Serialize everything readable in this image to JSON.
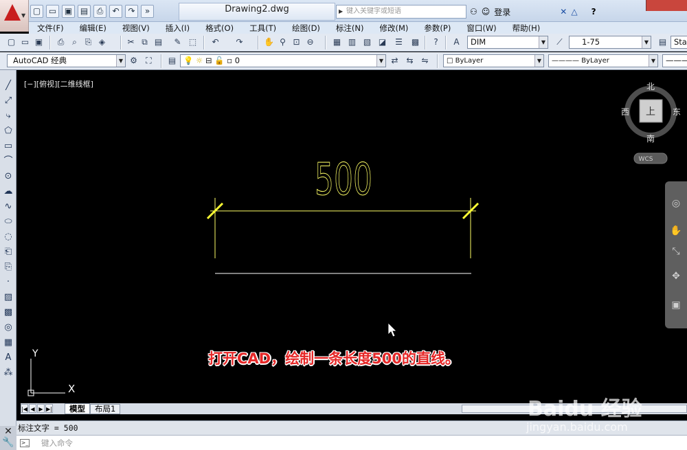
{
  "window": {
    "title": "Drawing2.dwg",
    "search_placeholder": "键入关键字或短语",
    "login_label": "登录"
  },
  "menu": {
    "items": [
      "文件(F)",
      "编辑(E)",
      "视图(V)",
      "插入(I)",
      "格式(O)",
      "工具(T)",
      "绘图(D)",
      "标注(N)",
      "修改(M)",
      "参数(P)",
      "窗口(W)",
      "帮助(H)"
    ]
  },
  "toolbar": {
    "dim_style": "DIM",
    "scale": "1-75",
    "text_style": "Sta",
    "workspace": "AutoCAD 经典",
    "layer": "0",
    "color": "ByLayer",
    "linetype": "ByLayer"
  },
  "viewport": {
    "label": "[−][俯视][二维线框]",
    "dimension_text": "500"
  },
  "viewcube": {
    "north": "北",
    "south": "南",
    "east": "东",
    "west": "西",
    "face": "上",
    "wcs_label": "WCS"
  },
  "ucs": {
    "y_label": "Y",
    "x_label": "X"
  },
  "tabs": {
    "model": "模型",
    "layout1": "布局1"
  },
  "command": {
    "history": "标注文字 = 500",
    "placeholder": "键入命令"
  },
  "caption": "打开CAD，绘制一条长度500的直线。",
  "watermark": {
    "brand": "Baidu 经验",
    "url": "jingyan.baidu.com"
  },
  "colors": {
    "accent_red": "#e62828",
    "dimension_yellow": "#ffff44",
    "line_white": "#ffffff"
  }
}
